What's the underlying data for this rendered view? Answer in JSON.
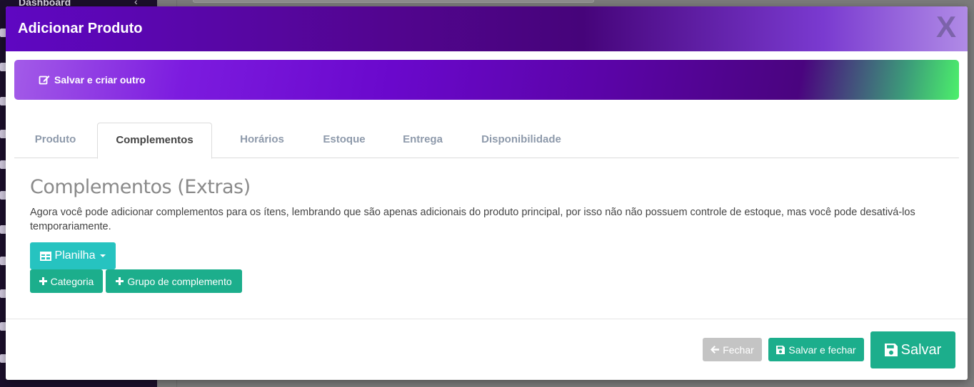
{
  "background": {
    "sidebar_item": "Dashboard"
  },
  "modal": {
    "title": "Adicionar Produto",
    "close_label": "X",
    "save_new_label": "Salvar e criar outro"
  },
  "tabs": [
    {
      "label": "Produto"
    },
    {
      "label": "Complementos"
    },
    {
      "label": "Horários"
    },
    {
      "label": "Estoque"
    },
    {
      "label": "Entrega"
    },
    {
      "label": "Disponibilidade"
    }
  ],
  "active_tab": "Complementos",
  "content": {
    "title": "Complementos (Extras)",
    "description": "Agora você pode adicionar complementos para os ítens, lembrando que são apenas adicionais do produto principal, por isso não não possuem controle de estoque, mas você pode desativá-los temporariamente.",
    "planilha_label": "Planilha",
    "categoria_label": "Categoria",
    "grupo_label": "Grupo de complemento"
  },
  "footer": {
    "fechar_label": "Fechar",
    "salvar_fechar_label": "Salvar e fechar",
    "salvar_label": "Salvar"
  },
  "colors": {
    "header_purple": "#5f07c2",
    "teal": "#26c3c0",
    "green": "#1cae8c",
    "gray_button": "#c4c4c4"
  },
  "icons": [
    "edit-icon",
    "table-icon",
    "plus-icon",
    "arrow-left-icon",
    "floppy-disk-icon",
    "close-icon",
    "chevron-left-icon"
  ]
}
